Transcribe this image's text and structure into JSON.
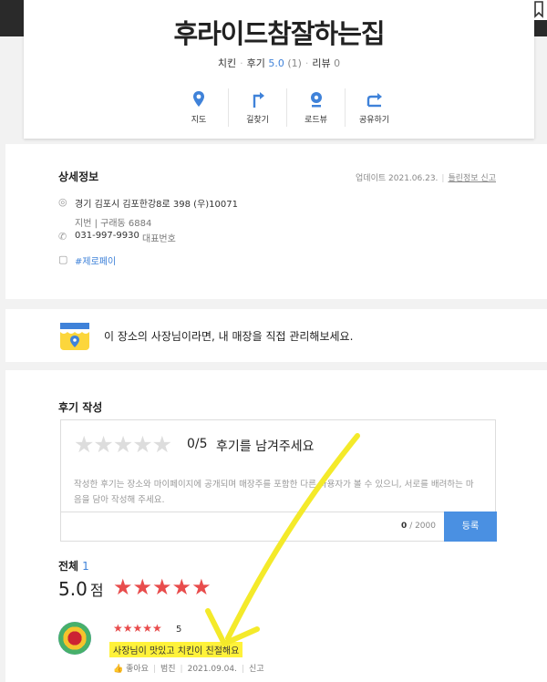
{
  "place": {
    "name": "후라이드참잘하는집",
    "category": "치킨",
    "reviews_label": "후기",
    "rating": "5.0",
    "review_count": "(1)",
    "comments_label": "리뷰",
    "comments_count": "0"
  },
  "actions": [
    {
      "label": "지도",
      "icon": "map-pin-icon"
    },
    {
      "label": "길찾기",
      "icon": "directions-icon"
    },
    {
      "label": "로드뷰",
      "icon": "roadview-icon"
    },
    {
      "label": "공유하기",
      "icon": "share-icon"
    }
  ],
  "detail": {
    "title": "상세정보",
    "updated": "업데이트 2021.06.23.",
    "report": "틀린정보 신고",
    "address": "경기 김포시 김포한강8로 398 (우)10071",
    "address_lot": "지번 | 구래동 6884",
    "phone": "031-997-9930",
    "phone_type": "대표번호",
    "tag": "#제로페이"
  },
  "owner_banner": "이 장소의 사장님이라면, 내 매장을 직접 관리해보세요.",
  "write_review": {
    "title": "후기 작성",
    "score": "0/5",
    "prompt": "후기를 남겨주세요",
    "notice": "작성한 후기는 장소와 마이페이지에 공개되며 매장주를 포함한 다른 사용자가 볼 수 있으니, 서로를 배려하는 마음을 담아 작성해 주세요.",
    "count": "0",
    "max": "/ 2000",
    "submit": "등록"
  },
  "summary": {
    "total_label": "전체",
    "total_count": "1",
    "average": "5.0",
    "unit": "점",
    "stars": "★★★★★"
  },
  "review": {
    "stars": "★★★★★",
    "score": "5",
    "text": "사장님이 맛있고 치킨이 친절해요",
    "like": "좋아요",
    "author": "범진",
    "date": "2021.09.04.",
    "report": "신고"
  },
  "colors": {
    "accent": "#4a90e2",
    "star": "#e84c4c",
    "highlight": "#fff23a"
  }
}
